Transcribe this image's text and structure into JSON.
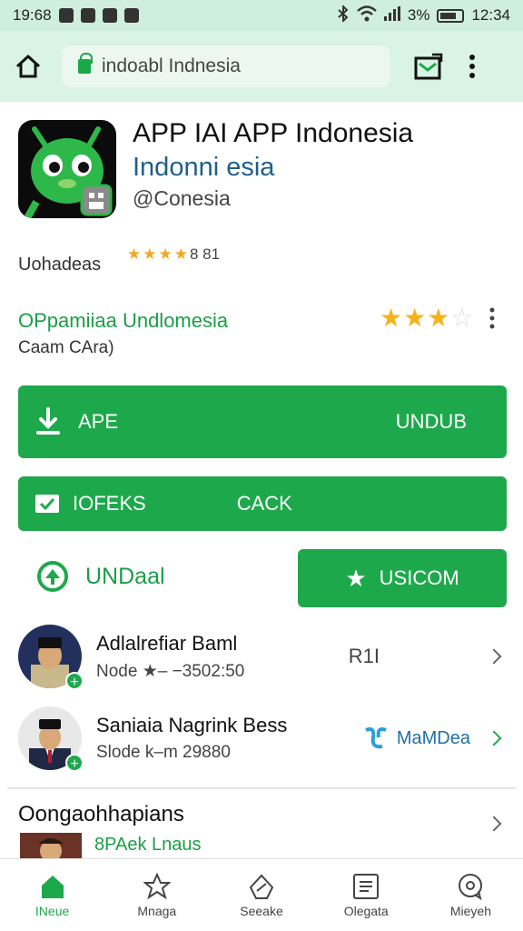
{
  "status_bar": {
    "time_left": "19:68",
    "battery": "3%",
    "time_right": "12:34"
  },
  "browser": {
    "url": "indoabl Indnesia"
  },
  "app": {
    "title": "APP IAI APP Indonesia",
    "subtitle": "Indonni esia",
    "developer": "@Conesia",
    "updates_label": "Uohadeas",
    "rating_text": "8 81"
  },
  "promo": {
    "title": "OPpamiiaa Undlomesia",
    "subtitle": "Caam CAra)",
    "stars_filled": 3,
    "stars_total": 4
  },
  "buttons": {
    "apk_left": "APE",
    "apk_right": "UNDUB",
    "check_left": "IOFEKS",
    "check_mid": "CACK",
    "undaal": "UNDaal",
    "uscom": "USICOM"
  },
  "people": [
    {
      "name": "Adlalrefiar Baml",
      "meta": "Node ★– −3502:50",
      "badge": "R1I"
    },
    {
      "name": "Saniaia Nagrink Bess",
      "meta": "Slode k–m 29880",
      "badge": "MaMDea"
    }
  ],
  "section": {
    "title": "Oongaohhapians",
    "subtitle": "8PAek Lnaus"
  },
  "nav": [
    {
      "label": "INeue",
      "icon": "home-icon",
      "active": true
    },
    {
      "label": "Mnaga",
      "icon": "star-icon",
      "active": false
    },
    {
      "label": "Seeake",
      "icon": "compass-icon",
      "active": false
    },
    {
      "label": "Olegata",
      "icon": "list-icon",
      "active": false
    },
    {
      "label": "Mieyeh",
      "icon": "chat-icon",
      "active": false
    }
  ],
  "colors": {
    "brand_green": "#1ea84c",
    "header_bg": "#d9f3e4",
    "star": "#f5b21b",
    "subtitle_blue": "#1f5f8b"
  }
}
